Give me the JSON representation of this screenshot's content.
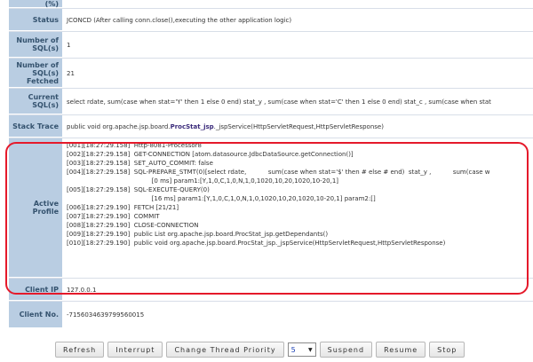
{
  "rows": {
    "top_label": "(%)",
    "status": {
      "label": "Status",
      "value": "JCONCD (After calling conn.close(),executing the other application logic)"
    },
    "num_sql": {
      "label": "Number of SQL(s)",
      "value": "1"
    },
    "num_sql_fetched": {
      "label": "Number of SQL(s) Fetched",
      "value": "21"
    },
    "current_sql": {
      "label": "Current SQL(s)",
      "value": "select rdate, sum(case when stat='Y' then 1 else 0 end) stat_y , sum(case when stat='C' then 1 else 0 end) stat_c , sum(case when stat"
    },
    "stack_trace": {
      "label": "Stack Trace",
      "value_prefix": "public void org.apache.jsp.board.",
      "value_bold": "ProcStat_jsp",
      "value_suffix": "._jspService(HttpServletRequest,HttpServletResponse)"
    },
    "active_profile": {
      "label": "Active Profile",
      "lines": [
        "[001][18:27:29.158]  Http-8081-Processor8",
        "[002][18:27:29.158]  GET-CONNECTION [atom.datasource.JdbcDataSource.getConnection()]",
        "[003][18:27:29.158]  SET_AUTO_COMMIT: false",
        "[004][18:27:29.158]  SQL-PREPARE_STMT(0)[select rdate,           sum(case when stat='$' then # else # end)  stat_y ,           sum(case w",
        "                                           [0 ms] param1:[Y,1,0,C,1,0,N,1,0,1020,10,20,1020,10-20,1]",
        "[005][18:27:29.158]  SQL-EXECUTE-QUERY(0)",
        "                                           [16 ms] param1:[Y,1,0,C,1,0,N,1,0,1020,10,20,1020,10-20,1] param2:[]",
        "[006][18:27:29.190]  FETCH [21/21]",
        "[007][18:27:29.190]  COMMIT",
        "[008][18:27:29.190]  CLOSE-CONNECTION",
        "[009][18:27:29.190]  public List org.apache.jsp.board.ProcStat_jsp.getDependants()",
        "[010][18:27:29.190]  public void org.apache.jsp.board.ProcStat_jsp._jspService(HttpServletRequest,HttpServletResponse)"
      ]
    },
    "client_ip": {
      "label": "Client IP",
      "value": "127.0.0.1"
    },
    "client_no": {
      "label": "Client No.",
      "value": "-7156034639799560015"
    }
  },
  "toolbar": {
    "refresh": "Refresh",
    "interrupt": "Interrupt",
    "change_priority": "Change Thread Priority",
    "priority_value": "5",
    "suspend": "Suspend",
    "resume": "Resume",
    "stop": "Stop"
  },
  "colors": {
    "label_bg": "#b9cde2",
    "highlight": "#e5192a",
    "link": "#1a3fb5"
  }
}
